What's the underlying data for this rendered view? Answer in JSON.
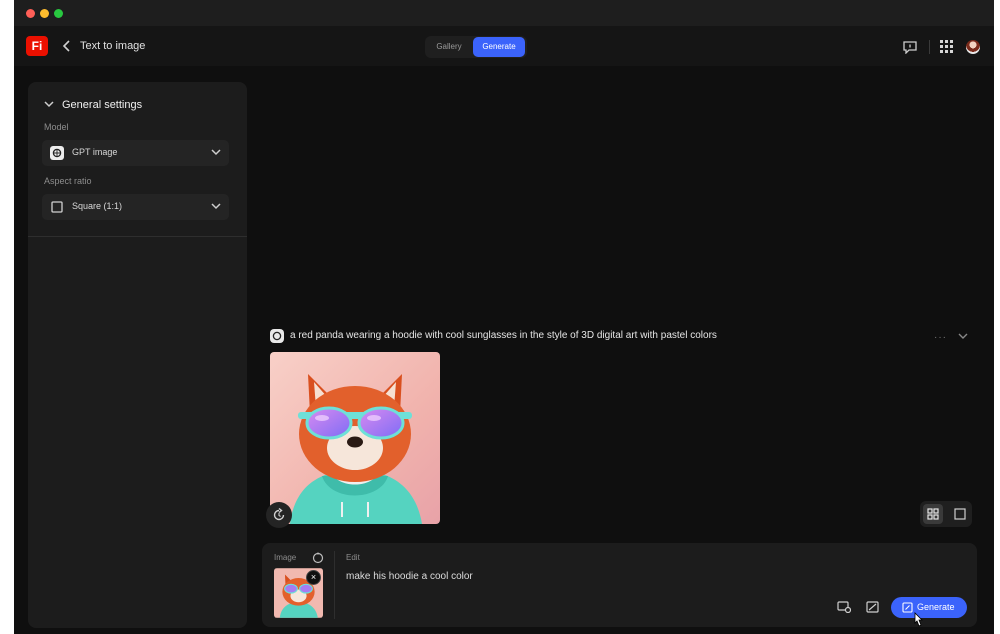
{
  "app": {
    "logo_text": "Fi",
    "page_title": "Text to image",
    "tabs": [
      {
        "label": "Gallery"
      },
      {
        "label": "Generate"
      }
    ],
    "accent_color": "#3b63fb",
    "logo_color": "#eb1000"
  },
  "sidebar": {
    "section_title": "General settings",
    "model": {
      "label": "Model",
      "value": "GPT image"
    },
    "aspect_ratio": {
      "label": "Aspect ratio",
      "value": "Square (1:1)"
    }
  },
  "feed": {
    "prompt": "a red panda wearing a hoodie with cool sunglasses in the style of 3D digital art with pastel colors",
    "more_label": "···"
  },
  "composer": {
    "image_label": "Image",
    "edit_label": "Edit",
    "edit_value": "make his hoodie a cool color",
    "generate_label": "Generate"
  },
  "icons": {
    "back": "chevron-left-icon",
    "feedback": "feedback-icon",
    "apps": "apps-grid-icon",
    "model": "openai-icon",
    "aspect": "square-icon",
    "refresh": "refresh-icon",
    "grid_view": "grid-view-icon",
    "single_view": "single-view-icon"
  }
}
